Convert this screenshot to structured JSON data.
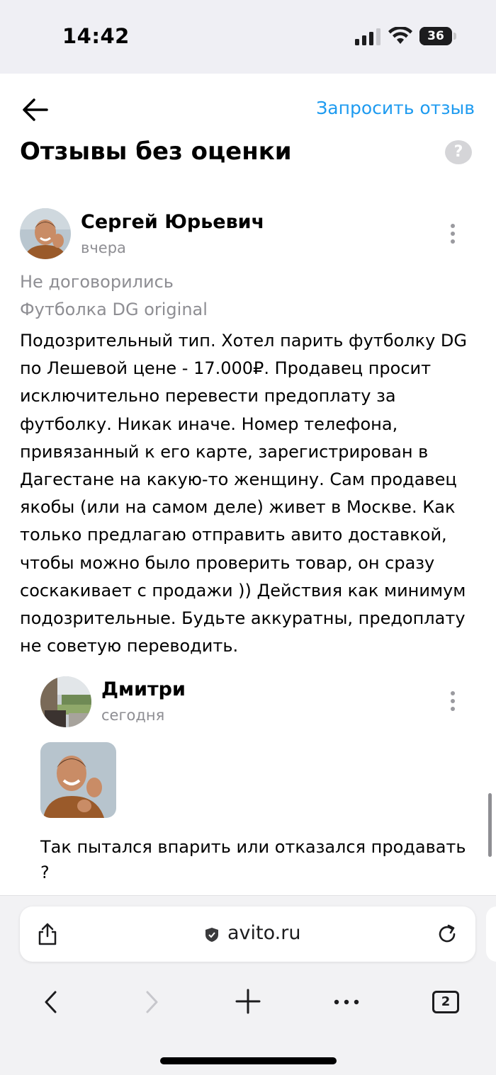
{
  "status_bar": {
    "time": "14:42",
    "battery_level": "36"
  },
  "header": {
    "request_review_link": "Запросить отзыв",
    "title": "Отзывы без оценки",
    "help_symbol": "?"
  },
  "review": {
    "author": "Сергей Юрьевич",
    "date": "вчера",
    "deal_status": "Не договорились",
    "item": "Футболка DG original",
    "text": "Подозрительный тип. Хотел парить футболку DG по Лешевой цене - 17.000₽. Продавец просит исключительно перевести предоплату за футболку. Никак иначе. Номер телефона, привязанный к его карте, зарегистрирован в Дагестане на какую-то женщину. Сам продавец якобы (или на самом деле) живет в Москве. Как только предлагаю отправить авито доставкой, чтобы можно было проверить товар, он сразу соскакивает с продажи )) Действия как минимум подозрительные. Будьте аккуратны, предоплату не советую переводить."
  },
  "reply": {
    "author": "Дмитри",
    "date": "сегодня",
    "text": "Так пытался впарить или отказался продавать ?"
  },
  "browser": {
    "url": "avito.ru",
    "tab_count": "2"
  },
  "colors": {
    "accent": "#1e9bf0",
    "secondary_text": "#8e8e93",
    "chrome_bg": "#f2f2f4"
  }
}
